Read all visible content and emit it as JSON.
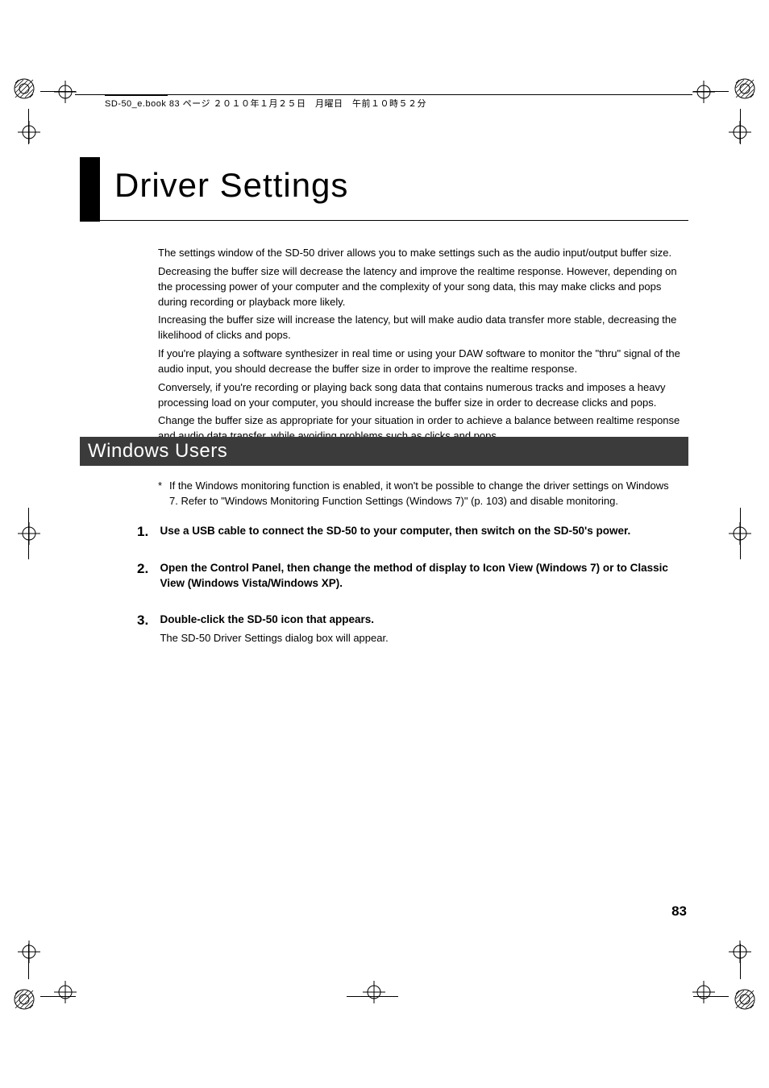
{
  "header_line": "SD-50_e.book  83 ページ  ２０１０年１月２５日　月曜日　午前１０時５２分",
  "title": "Driver Settings",
  "intro": [
    "The settings window of the SD-50 driver allows you to make settings such as the audio input/output buffer size.",
    "Decreasing the buffer size will decrease the latency and improve the realtime response. However, depending on the processing power of your computer and the complexity of your song data, this may make clicks and pops during recording or playback more likely.",
    "Increasing the buffer size will increase the latency, but will make audio data transfer more stable, decreasing the likelihood of clicks and pops.",
    "If you're playing a software synthesizer in real time or using your DAW software to monitor the \"thru\" signal of the audio input, you should decrease the buffer size in order to improve the realtime response.",
    "Conversely, if you're recording or playing back song data that contains numerous tracks and imposes a heavy processing load on your computer, you should increase the buffer size in order to decrease clicks and pops.",
    "Change the buffer size as appropriate for your situation in order to achieve a balance between realtime response and audio data transfer, while avoiding problems such as clicks and pops."
  ],
  "section": "Windows Users",
  "note_ast": "*",
  "note": "If the Windows monitoring function is enabled, it won't be possible to change the driver settings on Windows 7. Refer to  \"Windows Monitoring Function Settings (Windows 7)\" (p. 103) and disable monitoring.",
  "steps": [
    {
      "num": "1.",
      "lead": "Use a USB cable to connect the SD-50 to your computer, then switch on the SD-50's power.",
      "sub": ""
    },
    {
      "num": "2.",
      "lead": "Open the Control Panel, then change the method of display to Icon View (Windows 7) or to Classic View (Windows Vista/Windows XP).",
      "sub": ""
    },
    {
      "num": "3.",
      "lead": "Double-click the SD-50 icon that appears.",
      "sub": "The SD-50 Driver Settings dialog box will appear."
    }
  ],
  "page_number": "83"
}
